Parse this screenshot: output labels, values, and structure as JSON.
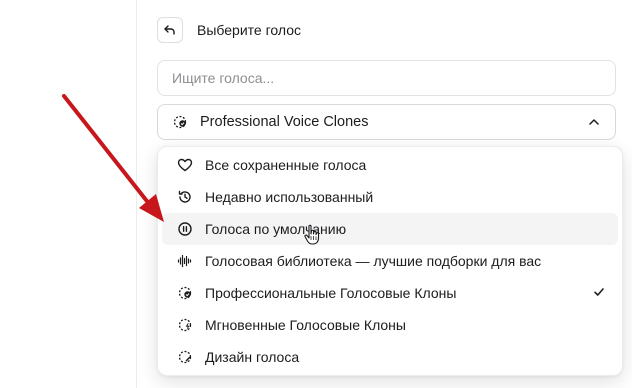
{
  "header": {
    "title": "Выберите голос"
  },
  "search": {
    "placeholder": "Ищите голоса..."
  },
  "select": {
    "label": "Professional Voice Clones"
  },
  "menu": {
    "items": [
      {
        "label": "Все сохраненные голоса",
        "icon": "heart-icon"
      },
      {
        "label": "Недавно использованный",
        "icon": "history-icon"
      },
      {
        "label": "Голоса по умолчанию",
        "icon": "pause-circle-icon",
        "hovered": true
      },
      {
        "label": "Голосовая библиотека — лучшие подборки для вас",
        "icon": "waveform-icon"
      },
      {
        "label": "Профессиональные Голосовые Клоны",
        "icon": "professional-clone-icon",
        "selected": true
      },
      {
        "label": "Мгновенные Голосовые Клоны",
        "icon": "instant-clone-icon"
      },
      {
        "label": "Дизайн голоса",
        "icon": "voice-design-icon"
      }
    ]
  },
  "colors": {
    "annotation_arrow": "#c8161d",
    "hover_bg": "#f4f4f5",
    "border": "#e2e2e2"
  }
}
